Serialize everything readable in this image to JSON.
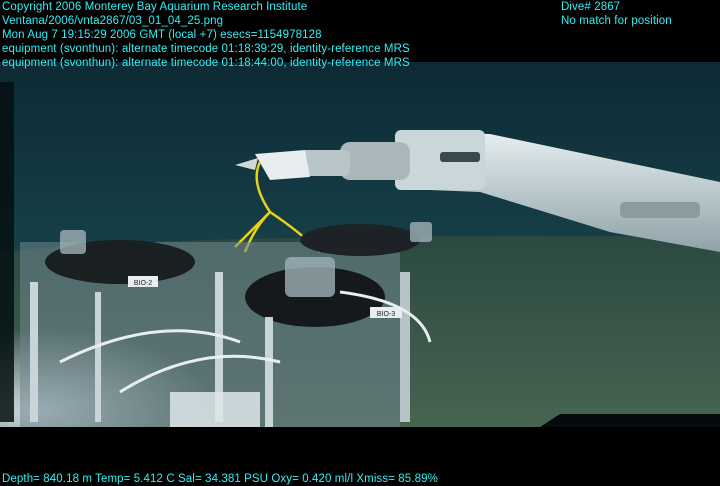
{
  "overlay": {
    "lines_left": [
      "Copyright 2006 Monterey Bay Aquarium Research Institute",
      "Ventana/2006/vnta2867/03_01_04_25.png",
      "Mon Aug  7 19:15:29 2006 GMT (local +7)  esecs=1154978128",
      "equipment (svonthun): alternate timecode 01:18:39:29, identity-reference MRS",
      "equipment (svonthun): alternate timecode 01:18:44:00, identity-reference MRS"
    ],
    "lines_right": [
      "Dive# 2867",
      "No match for position"
    ],
    "footer": "Depth= 840.18 m  Temp= 5.412 C  Sal= 34.381 PSU  Oxy= 0.420 ml/l  Xmiss= 85.89%"
  },
  "scene": {
    "labels": [
      "BIO-2",
      "BIO-3"
    ]
  },
  "colors": {
    "overlay_text": "#2ff0f6",
    "water": "#123a44",
    "seafloor": "#3d5a48"
  }
}
